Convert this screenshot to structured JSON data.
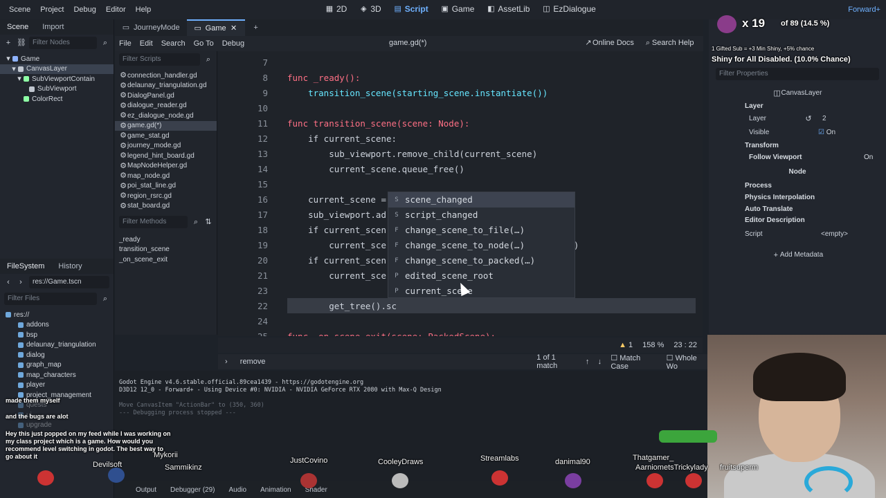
{
  "menubar": {
    "items": [
      "Scene",
      "Project",
      "Debug",
      "Editor",
      "Help"
    ],
    "workspaces": [
      {
        "label": "2D",
        "icon": "2d-icon"
      },
      {
        "label": "3D",
        "icon": "3d-icon"
      },
      {
        "label": "Script",
        "icon": "script-icon",
        "active": true
      },
      {
        "label": "Game",
        "icon": "game-icon"
      },
      {
        "label": "AssetLib",
        "icon": "assetlib-icon"
      },
      {
        "label": "EzDialogue",
        "icon": "ezdialogue-icon"
      }
    ],
    "renderer": "Forward+"
  },
  "scene_dock": {
    "tabs": [
      "Scene",
      "Import"
    ],
    "filter_placeholder": "Filter Nodes",
    "nodes": [
      {
        "label": "Game",
        "color": "#8fb3ff"
      },
      {
        "label": "CanvasLayer",
        "color": "#c0c6cf",
        "selected": true
      },
      {
        "label": "SubViewportContain",
        "color": "#8effa5"
      },
      {
        "label": "SubViewport",
        "color": "#c0c6cf"
      },
      {
        "label": "ColorRect",
        "color": "#8effa5"
      }
    ]
  },
  "filesystem": {
    "tabs": [
      "FileSystem",
      "History"
    ],
    "path": "res://Game.tscn",
    "filter_placeholder": "Filter Files",
    "items": [
      "res://",
      "addons",
      "bsp",
      "delaunay_triangulation",
      "dialog",
      "graph_map",
      "map_characters",
      "player",
      "project_management",
      "quests",
      "ui",
      "upgrade"
    ]
  },
  "script_list": {
    "filter_placeholder": "Filter Scripts",
    "scripts": [
      "connection_handler.gd",
      "delaunay_triangulation.gd",
      "DialogPanel.gd",
      "dialogue_reader.gd",
      "ez_dialogue_node.gd",
      "game.gd(*)",
      "game_stat.gd",
      "journey_mode.gd",
      "legend_hint_board.gd",
      "MapNodeHelper.gd",
      "map_node.gd",
      "poi_stat_line.gd",
      "region_rsrc.gd",
      "stat_board.gd"
    ],
    "selected": "game.gd(*)",
    "methods_placeholder": "Filter Methods",
    "methods": [
      "_ready",
      "transition_scene",
      "_on_scene_exit"
    ]
  },
  "editor_tabs": {
    "tabs": [
      "JourneyMode",
      "Game"
    ],
    "active": "Game"
  },
  "script_menu": {
    "items": [
      "File",
      "Edit",
      "Search",
      "Go To",
      "Debug"
    ],
    "title": "game.gd(*)",
    "online_docs": "Online Docs",
    "search_help": "Search Help"
  },
  "code": {
    "lines": [
      {
        "n": "7",
        "t": ""
      },
      {
        "n": "8",
        "t": "func _ready():"
      },
      {
        "n": "9",
        "t": "    transition_scene(starting_scene.instantiate())"
      },
      {
        "n": "10",
        "t": ""
      },
      {
        "n": "11",
        "t": "func transition_scene(scene: Node):"
      },
      {
        "n": "12",
        "t": "    if current_scene:"
      },
      {
        "n": "13",
        "t": "        sub_viewport.remove_child(current_scene)"
      },
      {
        "n": "14",
        "t": "        current_scene.queue_free()"
      },
      {
        "n": "15",
        "t": ""
      },
      {
        "n": "16",
        "t": "    current_scene ="
      },
      {
        "n": "17",
        "t": "    sub_viewport.ad"
      },
      {
        "n": "18",
        "t": "    if current_scen"
      },
      {
        "n": "19",
        "t": "        current_sce                                 xit)"
      },
      {
        "n": "20",
        "t": "    if current_scen"
      },
      {
        "n": "21",
        "t": "        current_sce"
      },
      {
        "n": "22",
        "t": "        get_tree().sc"
      },
      {
        "n": "24",
        "t": ""
      },
      {
        "n": "25",
        "t": "func _on_scene_exit(scene: PackedScene):"
      }
    ]
  },
  "autocomplete": {
    "options": [
      {
        "kind": "S",
        "label": "scene_changed"
      },
      {
        "kind": "S",
        "label": "script_changed"
      },
      {
        "kind": "F",
        "label": "change_scene_to_file(…)"
      },
      {
        "kind": "F",
        "label": "change_scene_to_node(…)"
      },
      {
        "kind": "F",
        "label": "change_scene_to_packed(…)"
      },
      {
        "kind": "P",
        "label": "edited_scene_root"
      },
      {
        "kind": "P",
        "label": "current_scene"
      }
    ]
  },
  "status": {
    "warnings": "1",
    "zoom": "158 %",
    "cursor": "23 :  22"
  },
  "findbar": {
    "query": "remove",
    "matches": "1 of 1 match",
    "match_case": "Match Case",
    "whole_words": "Whole Wo"
  },
  "output": {
    "lines": [
      "Godot Engine v4.6.stable.official.89cea1439 - https://godotengine.org",
      "D3D12 12_0 - Forward+ - Using Device #0: NVIDIA - NVIDIA GeForce RTX 2080 with Max-Q Design",
      "",
      "Move CanvasItem \"ActionBar\" to (350, 360)",
      "--- Debugging process stopped ---"
    ]
  },
  "bottom_tabs": [
    "Output",
    "Debugger (29)",
    "Audio",
    "Animation",
    "Shader"
  ],
  "inspector": {
    "node_name": "CanvasLayer",
    "sections": [
      {
        "label": "Layer"
      },
      {
        "label": "Transform"
      },
      {
        "label": "Follow Viewport"
      },
      {
        "label": "Process"
      },
      {
        "label": "Physics Interpolation"
      },
      {
        "label": "Auto Translate"
      },
      {
        "label": "Editor Description"
      }
    ],
    "layer_label": "Layer",
    "layer_value": "2",
    "visible_label": "Visible",
    "visible_value": "On",
    "follow_value": "On",
    "node_header": "Node",
    "script_label": "Script",
    "script_value": "<empty>",
    "add_metadata": "Add Metadata",
    "filter_placeholder": "Filter Properties"
  },
  "stream": {
    "counter": "x 19",
    "counter_detail": "of 89 (14.5 %)",
    "gift_text": "1 Gifted Sub = +3 Min Shiny, +5% chance",
    "shiny_text": "Shiny for All Disabled. (10.0% Chance)",
    "chat": [
      "made them myself",
      "and the bugs are alot",
      "Hey this just popped on my feed while I was working on my class project which is a game. How would you recommend level switching in godot. The best way to go about it"
    ],
    "viewers": [
      "Mykorii",
      "JustCovino",
      "CooleyDraws",
      "Streamlabs",
      "danimal90",
      "Thatgamer_",
      "fruitsuperm",
      "Sammikinz",
      "AarniometsTrickylady",
      "Devilsoft"
    ]
  }
}
